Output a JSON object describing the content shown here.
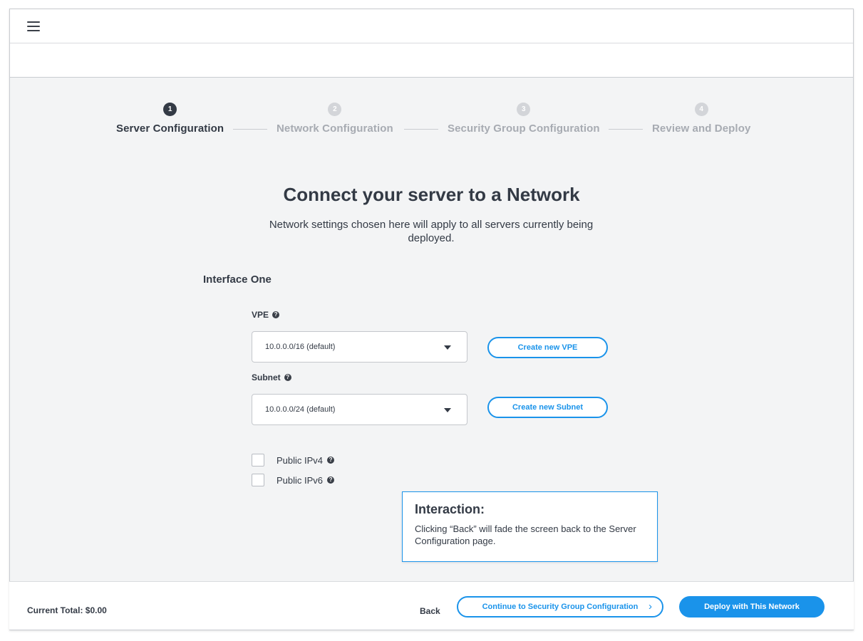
{
  "stepper": {
    "steps": [
      {
        "number": "1",
        "label": "Server Configuration",
        "state": "active"
      },
      {
        "number": "2",
        "label": "Network Configuration",
        "state": "inactive"
      },
      {
        "number": "3",
        "label": "Security Group Configuration",
        "state": "inactive"
      },
      {
        "number": "4",
        "label": "Review and Deploy",
        "state": "inactive"
      }
    ]
  },
  "main": {
    "title": "Connect your server to a Network",
    "subtitle": "Network settings chosen here will apply to all servers currently being deployed.",
    "section_title": "Interface One",
    "vpe": {
      "label": "VPE",
      "value": "10.0.0.0/16 (default)",
      "create_label": "Create new VPE"
    },
    "subnet": {
      "label": "Subnet",
      "value": "10.0.0.0/24 (default)",
      "create_label": "Create new Subnet"
    },
    "options": [
      {
        "label": "Public IPv4",
        "checked": false
      },
      {
        "label": "Public IPv6",
        "checked": false
      }
    ],
    "help_glyph": "?"
  },
  "annotation": {
    "title": "Interaction:",
    "body": "Clicking “Back” will fade the screen back to the Server Configuration page."
  },
  "footer": {
    "total_label": "Current Total: $0.00",
    "back_label": "Back",
    "continue_label": "Continue to Security Group Configuration",
    "continue_chevron": "›",
    "deploy_label": "Deploy with This Network"
  },
  "colors": {
    "accent": "#1a93ea",
    "text_dark": "#333a45",
    "inactive_step": "#a7abb2",
    "background": "#f3f4f5"
  }
}
